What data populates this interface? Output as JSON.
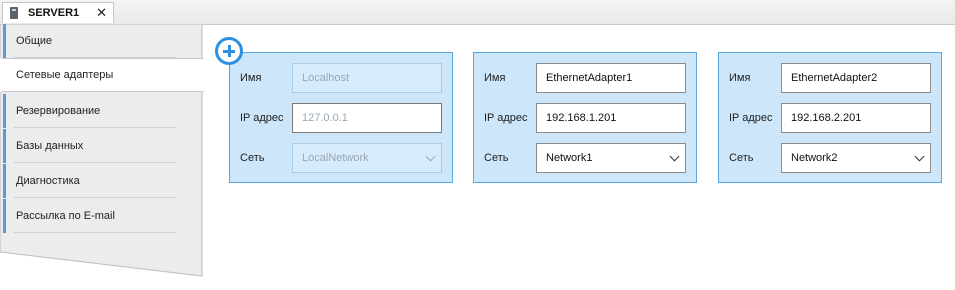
{
  "tab": {
    "title": "SERVER1",
    "close": "✕"
  },
  "nav": {
    "items": [
      {
        "label": "Общие"
      },
      {
        "label": "Сетевые адаптеры"
      },
      {
        "label": "Резервирование"
      },
      {
        "label": "Базы данных"
      },
      {
        "label": "Диагностика"
      },
      {
        "label": "Рассылка по E-mail"
      }
    ],
    "active_index": 1
  },
  "labels": {
    "name": "Имя",
    "ip": "IP адрес",
    "network": "Сеть"
  },
  "adapters": [
    {
      "name": "Localhost",
      "ip": "127.0.0.1",
      "network": "LocalNetwork",
      "state": "disabled"
    },
    {
      "name": "EthernetAdapter1",
      "ip": "192.168.1.201",
      "network": "Network1",
      "state": "enabled"
    },
    {
      "name": "EthernetAdapter2",
      "ip": "192.168.2.201",
      "network": "Network2",
      "state": "enabled"
    }
  ],
  "colors": {
    "accent": "#2e90e0",
    "card_bg": "#cde6f9",
    "card_border": "#59a7e0",
    "nav_bg": "#ececec"
  }
}
